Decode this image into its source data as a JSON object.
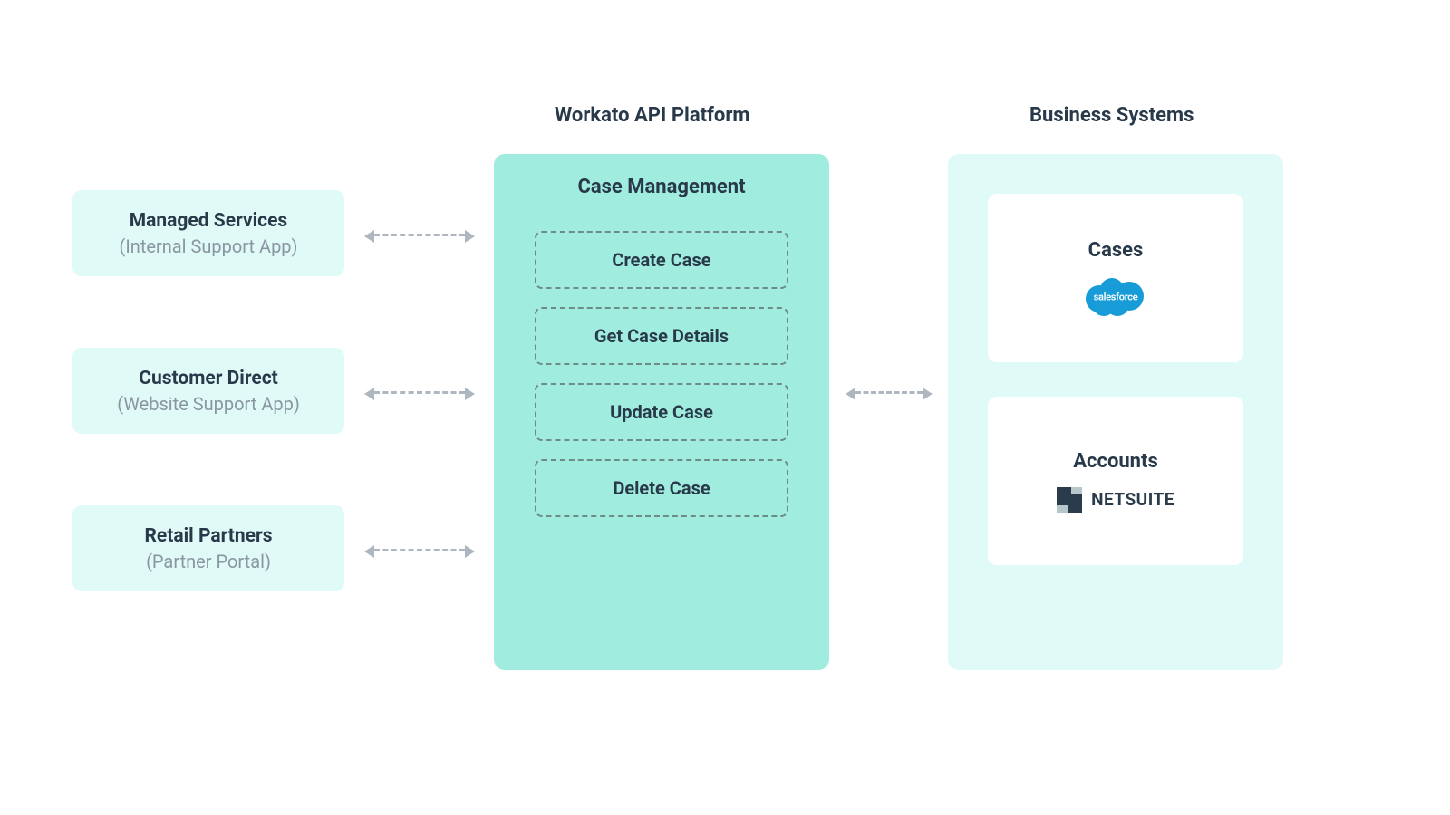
{
  "headings": {
    "platform": "Workato API Platform",
    "business": "Business Systems"
  },
  "clients": [
    {
      "title": "Managed Services",
      "sub": "(Internal Support App)"
    },
    {
      "title": "Customer Direct",
      "sub": "(Website Support App)"
    },
    {
      "title": "Retail Partners",
      "sub": "(Partner Portal)"
    }
  ],
  "platform": {
    "title": "Case Management",
    "ops": [
      "Create Case",
      "Get Case Details",
      "Update Case",
      "Delete Case"
    ]
  },
  "business": {
    "cards": [
      {
        "title": "Cases",
        "system": "salesforce"
      },
      {
        "title": "Accounts",
        "system": "NETSUITE"
      }
    ]
  }
}
